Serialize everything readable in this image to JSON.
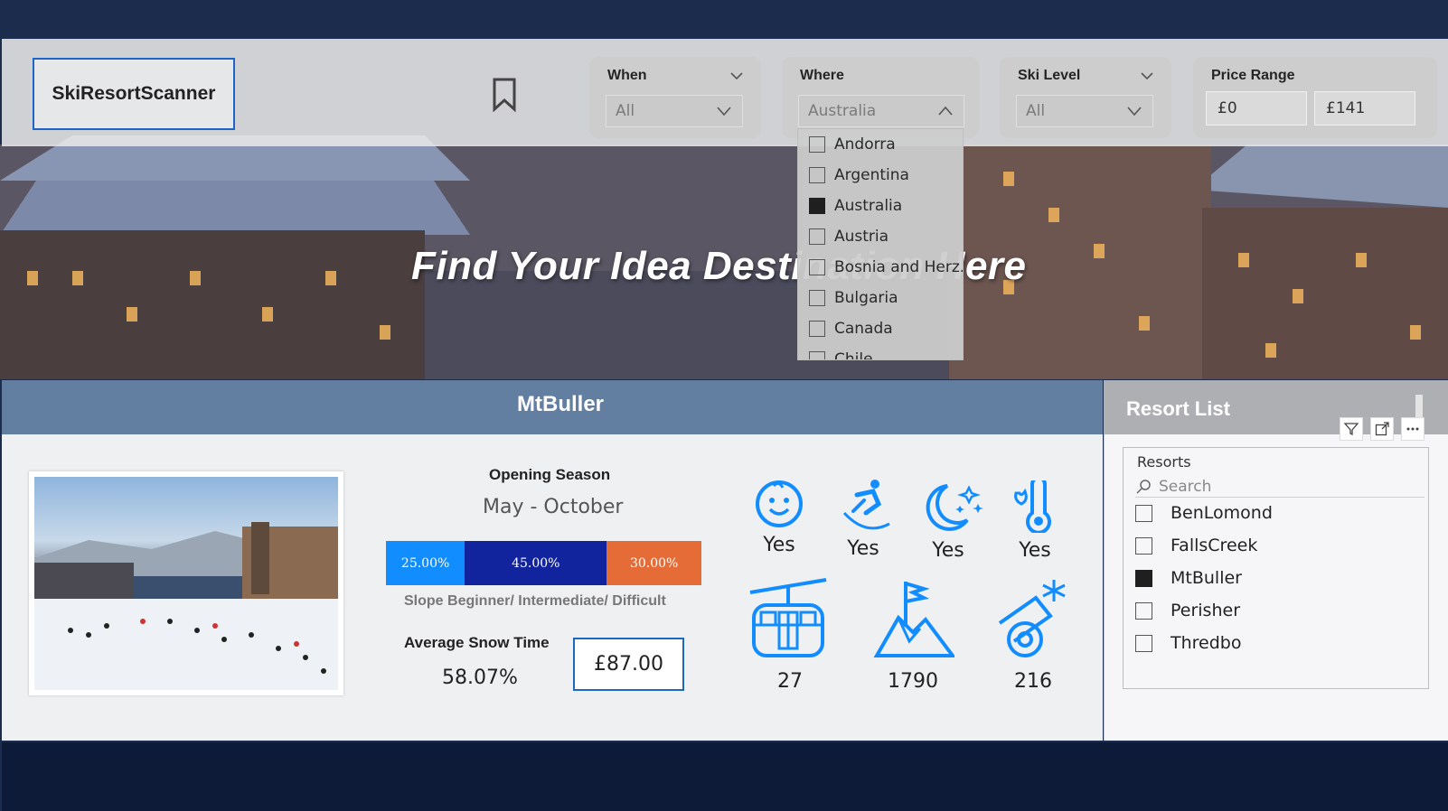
{
  "app": {
    "logo_text": "SkiResortScanner",
    "headline": "Find Your Idea Destination Here"
  },
  "filters": {
    "when": {
      "title": "When",
      "value": "All"
    },
    "where": {
      "title": "Where",
      "value": "Australia",
      "options": [
        {
          "label": "Andorra",
          "checked": false
        },
        {
          "label": "Argentina",
          "checked": false
        },
        {
          "label": "Australia",
          "checked": true
        },
        {
          "label": "Austria",
          "checked": false
        },
        {
          "label": "Bosnia and Herz...",
          "checked": false
        },
        {
          "label": "Bulgaria",
          "checked": false
        },
        {
          "label": "Canada",
          "checked": false
        },
        {
          "label": "Chile",
          "checked": false
        }
      ]
    },
    "ski_level": {
      "title": "Ski Level",
      "value": "All"
    },
    "price_range": {
      "title": "Price Range",
      "min": "£0",
      "max": "£141"
    }
  },
  "resort": {
    "name": "MtBuller",
    "opening_season_label": "Opening Season",
    "opening_season": "May - October",
    "slope_label": "Slope Beginner/ Intermediate/ Difficult",
    "slope_split": [
      {
        "label": "25.00%",
        "value": 25,
        "color": "#118dff"
      },
      {
        "label": "45.00%",
        "value": 45,
        "color": "#12239e"
      },
      {
        "label": "30.00%",
        "value": 30,
        "color": "#e66c37"
      }
    ],
    "avg_snow_label": "Average Snow Time",
    "avg_snow": "58.07%",
    "price": "£87.00",
    "features": [
      {
        "icon": "kids-smiley-icon",
        "value": "Yes"
      },
      {
        "icon": "snowboarder-icon",
        "value": "Yes"
      },
      {
        "icon": "night-skiing-icon",
        "value": "Yes"
      },
      {
        "icon": "thermometer-icon",
        "value": "Yes"
      }
    ],
    "stats": [
      {
        "icon": "gondola-lift-icon",
        "value": "27"
      },
      {
        "icon": "mountain-flag-icon",
        "value": "1790"
      },
      {
        "icon": "snow-cannon-icon",
        "value": "216"
      }
    ]
  },
  "resort_list": {
    "title": "Resort List",
    "header": "Resorts",
    "search_placeholder": "Search",
    "items": [
      {
        "label": "BenLomond",
        "checked": false
      },
      {
        "label": "FallsCreek",
        "checked": false
      },
      {
        "label": "MtBuller",
        "checked": true
      },
      {
        "label": "Perisher",
        "checked": false
      },
      {
        "label": "Thredbo",
        "checked": false
      }
    ]
  },
  "colors": {
    "accent": "#1e64c8",
    "icon_blue": "#118dff"
  }
}
